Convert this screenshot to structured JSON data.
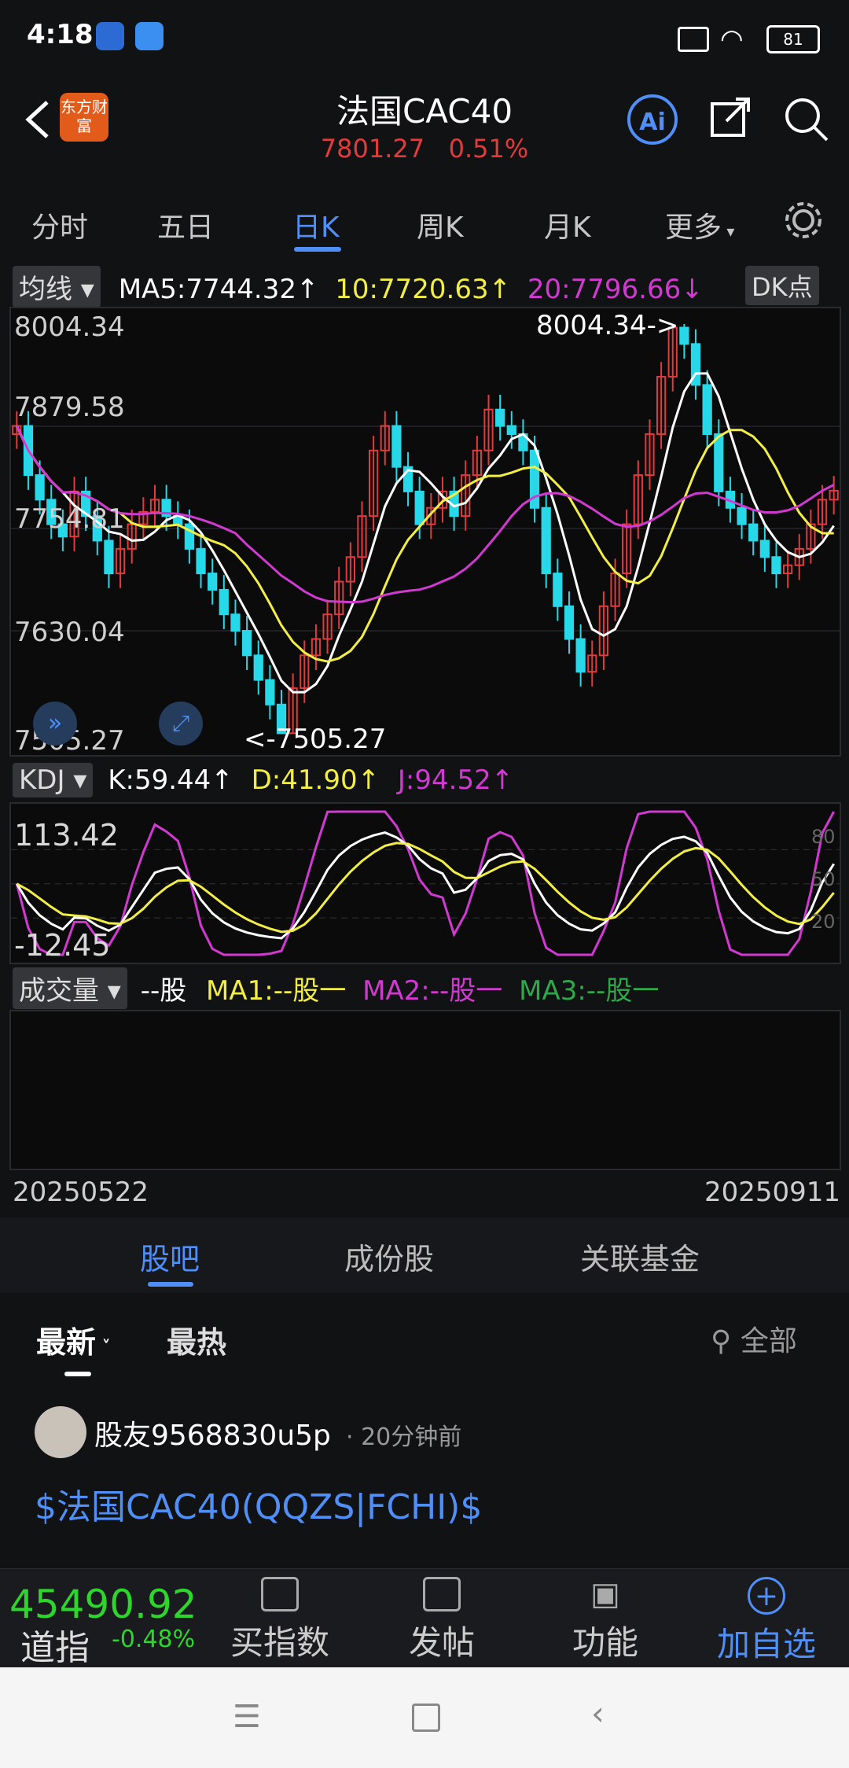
{
  "status": {
    "time": "4:18",
    "battery": "81"
  },
  "header": {
    "app_logo_text": "东方财富",
    "title": "法国CAC40",
    "price": "7801.27",
    "change": "0.51%"
  },
  "tabs": [
    "分时",
    "五日",
    "日K",
    "周K",
    "月K",
    "更多"
  ],
  "ma_legend": {
    "label": "均线",
    "ma5": "MA5:7744.32",
    "ma10": "10:7720.63",
    "ma20": "20:7796.66",
    "arrow_up": "↑",
    "arrow_down": "↓",
    "dk": "DK点"
  },
  "price_axis": [
    "8004.34",
    "7879.58",
    "7754.81",
    "7630.04",
    "7505.27"
  ],
  "price_annotations": {
    "high": "8004.34->",
    "low": "<-7505.27"
  },
  "kdj": {
    "label": "KDJ",
    "k": "K:59.44",
    "d": "D:41.90",
    "j": "J:94.52",
    "arrow": "↑",
    "axis_top": "113.42",
    "axis_bottom": "-12.45",
    "right_80": "80",
    "right_50": "50",
    "right_20": "20"
  },
  "volume": {
    "label": "成交量",
    "unit": "--股",
    "ma1": "MA1:--股一",
    "ma2": "MA2:--股一",
    "ma3": "MA3:--股一"
  },
  "dates": {
    "start": "20250522",
    "end": "20250911"
  },
  "section_tabs": [
    "股吧",
    "成份股",
    "关联基金"
  ],
  "filter_tabs": {
    "latest": "最新",
    "hot": "最热",
    "all": "全部"
  },
  "post": {
    "user": "股友9568830u5p",
    "dot": "·",
    "time": "20分钟前",
    "content": "$法国CAC40(QQZS|FCHI)$"
  },
  "bottom_bar": {
    "index_value": "45490.92",
    "index_name": "道指",
    "index_change": "-0.48%",
    "buy": "买指数",
    "post": "发帖",
    "func": "功能",
    "add": "加自选"
  },
  "colors": {
    "up": "#e23b3b",
    "down": "#26d8e8",
    "accent": "#4f8ff7",
    "ma5": "#ffffff",
    "ma10": "#f2ee46",
    "ma20": "#d13ad1"
  },
  "chart_data": {
    "type": "candlestick",
    "x_start": "20250522",
    "x_end": "20250911",
    "ylim": [
      7505.27,
      8004.34
    ],
    "closes": [
      7880,
      7820,
      7790,
      7760,
      7745,
      7800,
      7770,
      7740,
      7700,
      7730,
      7760,
      7775,
      7790,
      7770,
      7760,
      7730,
      7700,
      7680,
      7650,
      7630,
      7600,
      7570,
      7540,
      7505,
      7560,
      7600,
      7620,
      7650,
      7690,
      7720,
      7770,
      7850,
      7880,
      7830,
      7800,
      7760,
      7780,
      7800,
      7770,
      7820,
      7850,
      7900,
      7880,
      7870,
      7850,
      7780,
      7700,
      7660,
      7620,
      7580,
      7600,
      7660,
      7700,
      7760,
      7820,
      7870,
      7940,
      8000,
      7980,
      7930,
      7870,
      7800,
      7780,
      7760,
      7740,
      7720,
      7700,
      7710,
      7730,
      7760,
      7790,
      7801
    ]
  }
}
